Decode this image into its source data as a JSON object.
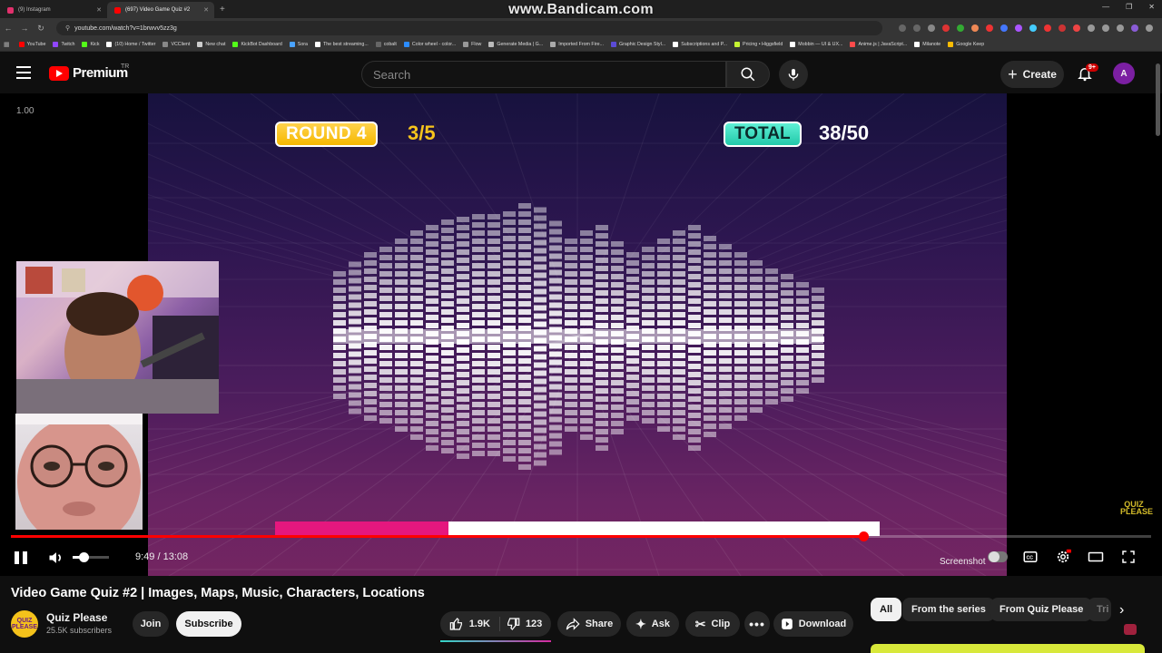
{
  "browser": {
    "tabs": [
      {
        "title": "(9) Instagram",
        "color": "#e1306c"
      },
      {
        "title": "(697) Video Game Quiz #2",
        "color": "#ff0000"
      }
    ],
    "recorder_watermark": "www.Bandicam.com",
    "url": "youtube.com/watch?v=1brwvv5zz3g",
    "bookmarks": [
      {
        "label": "YouTube",
        "color": "#ff0000"
      },
      {
        "label": "Twitch",
        "color": "#9146ff"
      },
      {
        "label": "Kick",
        "color": "#53fc18"
      },
      {
        "label": "(10) Home / Twitter",
        "color": "#ffffff"
      },
      {
        "label": "VCClient",
        "color": "#888888"
      },
      {
        "label": "New chat",
        "color": "#cccccc"
      },
      {
        "label": "KickBot Dashboard",
        "color": "#53fc18"
      },
      {
        "label": "Sora",
        "color": "#4aa3ff"
      },
      {
        "label": "The best streaming...",
        "color": "#ffffff"
      },
      {
        "label": "cobalt",
        "color": "#666666"
      },
      {
        "label": "Color wheel - color...",
        "color": "#2b8cff"
      },
      {
        "label": "Flow",
        "color": "#999999"
      },
      {
        "label": "Generate Media | G...",
        "color": "#bbbbbb"
      },
      {
        "label": "Imported From Fire...",
        "color": "#aaaaaa"
      },
      {
        "label": "Graphic Design Styl...",
        "color": "#5b4bd6"
      },
      {
        "label": "Subscriptions and P...",
        "color": "#ffffff"
      },
      {
        "label": "Pricing • Higgsfield",
        "color": "#c6f432"
      },
      {
        "label": "Mobbin — UI & UX...",
        "color": "#ffffff"
      },
      {
        "label": "Anime.js | JavaScript...",
        "color": "#ff4b4b"
      },
      {
        "label": "Milanote",
        "color": "#ffffff"
      },
      {
        "label": "Google Keep",
        "color": "#fbbc04"
      }
    ]
  },
  "header": {
    "logo_text": "Premium",
    "country": "TR",
    "search_placeholder": "Search",
    "create_label": "Create",
    "notification_badge": "9+",
    "avatar_letter": "A"
  },
  "player": {
    "speed_label": "1.00",
    "round_label": "ROUND 4",
    "round_score": "3/5",
    "total_label": "TOTAL",
    "total_score": "38/50",
    "timer_fraction": 0.287,
    "progress_fraction": 0.748,
    "volume_fraction": 0.3,
    "time_display": "9:49 / 13:08",
    "screenshot_label": "Screenshot",
    "watermark": "QUIZ PLEASE"
  },
  "video": {
    "title": "Video Game Quiz #2 | Images, Maps, Music, Characters, Locations",
    "channel_name": "Quiz Please",
    "channel_avatar_text": "QUIZ PLEASE",
    "subscribers": "25.5K subscribers",
    "join_label": "Join",
    "subscribe_label": "Subscribe",
    "likes": "1.9K",
    "dislikes": "123",
    "share_label": "Share",
    "ask_label": "Ask",
    "clip_label": "Clip",
    "download_label": "Download"
  },
  "chips": [
    "All",
    "From the series",
    "From Quiz Please",
    "Tri"
  ]
}
